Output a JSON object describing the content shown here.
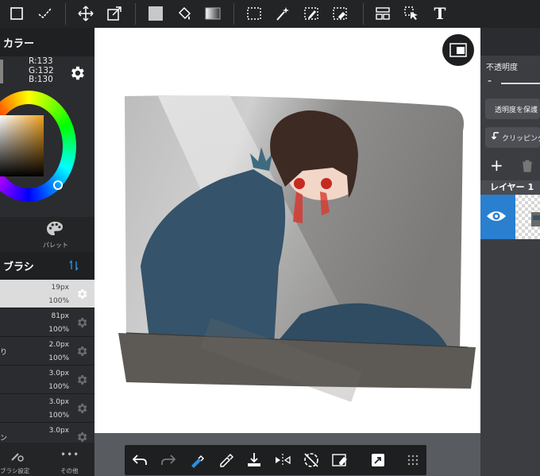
{
  "toolbar": {
    "tools": [
      "square-select-icon",
      "check-icon",
      "move-icon",
      "transform-icon",
      "fill-color-icon",
      "bucket-icon",
      "gradient-icon",
      "marquee-icon",
      "magic-wand-icon",
      "selection-pen-icon",
      "selection-eraser-icon",
      "layout-icon",
      "select-layer-icon",
      "text-icon"
    ],
    "text_tool_label": "T"
  },
  "color_panel": {
    "title": "カラー",
    "r": "R:133",
    "g": "G:132",
    "b": "B:130",
    "current_color": "#858482"
  },
  "palette": {
    "label": "パレット"
  },
  "brush_panel": {
    "title": "ブラシ",
    "brushes": [
      {
        "name": "",
        "size": "19px",
        "opacity": "100%"
      },
      {
        "name": "",
        "size": "81px",
        "opacity": "100%"
      },
      {
        "name": "り",
        "size": "2.0px",
        "opacity": "100%"
      },
      {
        "name": "",
        "size": "3.0px",
        "opacity": "100%"
      },
      {
        "name": "",
        "size": "3.0px",
        "opacity": "100%"
      },
      {
        "name": "ン",
        "size": "3.0px",
        "opacity": ""
      }
    ],
    "selected_index": 0
  },
  "left_footer": {
    "brush_settings": "ブラシ設定",
    "more": "その他",
    "more_icon": "•••"
  },
  "right_panel": {
    "opacity_label": "不透明度",
    "opacity_minus": "-",
    "protect_alpha": "透明度を保護",
    "clipping": "クリッピング",
    "layer_header": "レイヤー 1",
    "add_icon": "+"
  },
  "bottom_toolbar": {
    "tools": [
      "undo-icon",
      "redo-icon",
      "eyedropper-brush-icon",
      "eyedropper-icon",
      "import-icon",
      "flip-icon",
      "rotate-cancel-icon",
      "eraser-icon",
      "share-icon",
      "grid-icon"
    ]
  },
  "colors": {
    "accent": "#2a7fd0",
    "toolbar": "#232426",
    "canvas_bg": "#ffffff"
  }
}
